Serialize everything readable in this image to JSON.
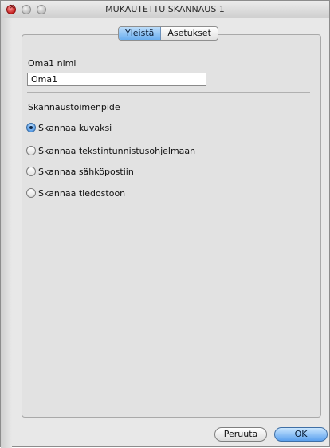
{
  "window": {
    "title": "MUKAUTETTU SKANNAUS 1"
  },
  "tabs": [
    {
      "label": "Yleistä",
      "active": true
    },
    {
      "label": "Asetukset",
      "active": false
    }
  ],
  "name_field": {
    "label": "Oma1 nimi",
    "value": "Oma1"
  },
  "scan_action": {
    "label": "Skannaustoimenpide",
    "options": [
      {
        "label": "Skannaa kuvaksi",
        "selected": true
      },
      {
        "label": "Skannaa tekstintunnistusohjelmaan",
        "selected": false
      },
      {
        "label": "Skannaa sähköpostiin",
        "selected": false
      },
      {
        "label": "Skannaa tiedostoon",
        "selected": false
      }
    ]
  },
  "buttons": {
    "cancel": "Peruuta",
    "ok": "OK"
  },
  "colors": {
    "accent": "#5aa0ee",
    "panel_bg": "#e2e2e2",
    "window_bg": "#e8e8e8"
  }
}
